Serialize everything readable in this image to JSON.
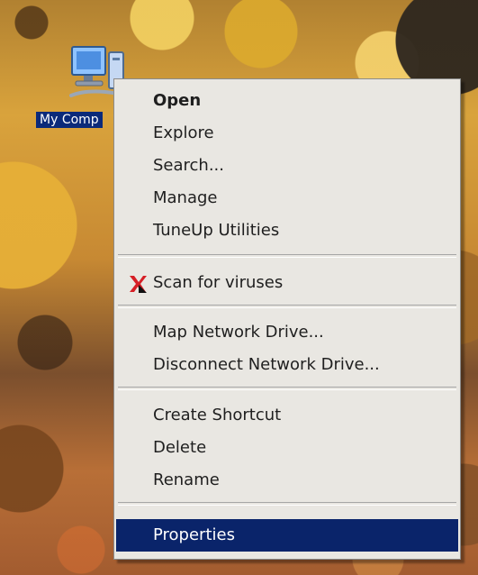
{
  "desktop": {
    "icon_label": "My Comp",
    "icon_name": "my-computer-icon"
  },
  "context_menu": {
    "items": [
      {
        "label": "Open",
        "style": "bold"
      },
      {
        "label": "Explore"
      },
      {
        "label": "Search..."
      },
      {
        "label": "Manage"
      },
      {
        "label": "TuneUp Utilities"
      },
      {
        "label": "Scan for viruses",
        "icon": "kaspersky-icon"
      },
      {
        "label": "Map Network Drive..."
      },
      {
        "label": "Disconnect Network Drive..."
      },
      {
        "label": "Create Shortcut"
      },
      {
        "label": "Delete"
      },
      {
        "label": "Rename"
      },
      {
        "label": "Properties",
        "state": "selected"
      }
    ]
  },
  "colors": {
    "menu_background": "#e9e7e2",
    "selection": "#0a246a",
    "desktop_label_background": "#0b2a7a",
    "menu_text": "#1f1f1f",
    "scan_icon_red": "#d61f26"
  }
}
